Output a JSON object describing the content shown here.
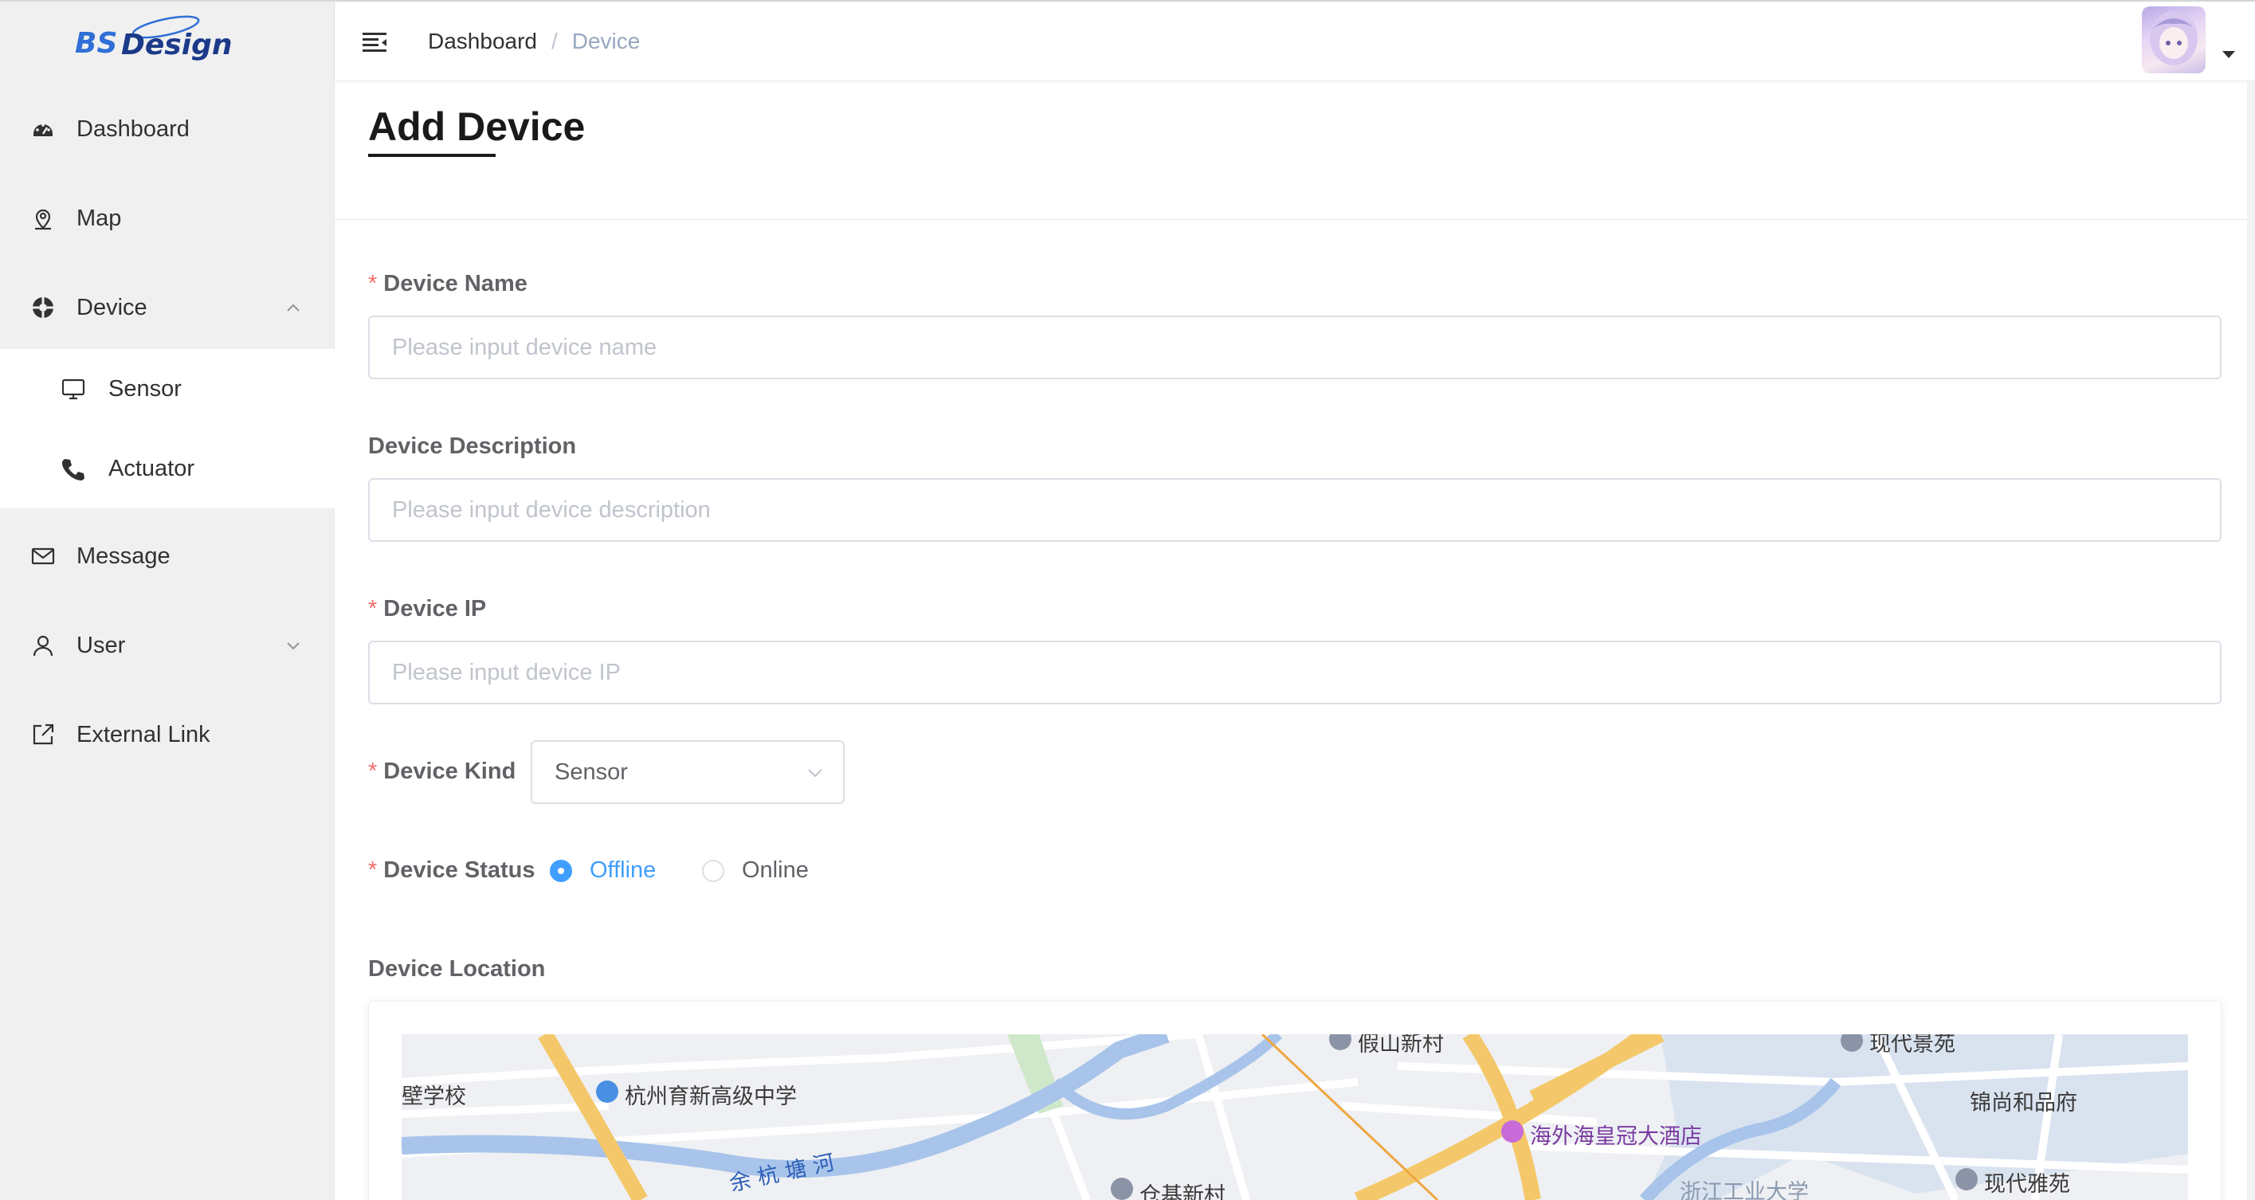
{
  "brand": {
    "logo_text": "BSDesign"
  },
  "sidebar": {
    "items": [
      {
        "label": "Dashboard",
        "icon": "dashboard-icon"
      },
      {
        "label": "Map",
        "icon": "map-pin-icon"
      },
      {
        "label": "Device",
        "icon": "device-icon",
        "expanded": true
      },
      {
        "label": "Message",
        "icon": "mail-icon"
      },
      {
        "label": "User",
        "icon": "user-icon",
        "expanded": false
      },
      {
        "label": "External Link",
        "icon": "external-link-icon"
      }
    ],
    "device_children": [
      {
        "label": "Sensor",
        "icon": "monitor-icon"
      },
      {
        "label": "Actuator",
        "icon": "phone-icon"
      }
    ]
  },
  "header": {
    "breadcrumb": [
      "Dashboard",
      "Device"
    ],
    "separator": "/"
  },
  "page": {
    "title": "Add Device"
  },
  "form": {
    "required_mark": "*",
    "device_name": {
      "label": "Device Name",
      "placeholder": "Please input device name",
      "value": ""
    },
    "device_description": {
      "label": "Device Description",
      "placeholder": "Please input device description",
      "value": ""
    },
    "device_ip": {
      "label": "Device IP",
      "placeholder": "Please input device IP",
      "value": ""
    },
    "device_kind": {
      "label": "Device Kind",
      "selected": "Sensor"
    },
    "device_status": {
      "label": "Device Status",
      "options": [
        "Offline",
        "Online"
      ],
      "selected": "Offline"
    },
    "device_location": {
      "label": "Device Location"
    }
  },
  "map": {
    "labels": [
      "壁学校",
      "杭州育新高级中学",
      "余 杭 塘 河",
      "假山新村",
      "仓基新村",
      "海外海皇冠大酒店",
      "浙江工业大学",
      "现代景苑",
      "锦尚和品府",
      "现代雅苑"
    ]
  },
  "colors": {
    "accent": "#409eff",
    "required": "#f56c6c",
    "sidebar_bg": "#f0f0f0"
  }
}
